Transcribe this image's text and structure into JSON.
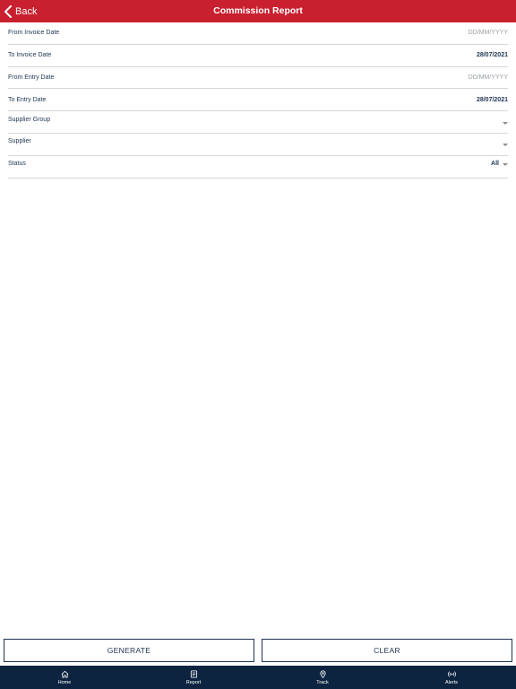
{
  "header": {
    "back_label": "Back",
    "title": "Commission Report"
  },
  "form": {
    "rows": [
      {
        "label": "From Invoice Date",
        "value": "DD/MM/YYYY",
        "placeholder": true
      },
      {
        "label": "To Invoice Date",
        "value": "28/07/2021",
        "placeholder": false
      },
      {
        "label": "From Entry Date",
        "value": "DD/MM/YYYY",
        "placeholder": true
      },
      {
        "label": "To Entry Date",
        "value": "28/07/2021",
        "placeholder": false
      },
      {
        "label": "Supplier Group",
        "value": "",
        "dropdown": true
      },
      {
        "label": "Supplier",
        "value": "",
        "dropdown": true
      },
      {
        "label": "Status",
        "value": "All",
        "dropdown": true
      }
    ]
  },
  "actions": {
    "generate_label": "GENERATE",
    "clear_label": "CLEAR"
  },
  "tabbar": {
    "items": [
      {
        "label": "Home",
        "icon": "home-icon"
      },
      {
        "label": "Report",
        "icon": "report-icon"
      },
      {
        "label": "Track",
        "icon": "location-pin-icon"
      },
      {
        "label": "Alerts",
        "icon": "broadcast-icon"
      }
    ]
  },
  "colors": {
    "header_bg": "#c8202f",
    "tabbar_bg": "#0d2440",
    "text_primary": "#1f3552"
  }
}
